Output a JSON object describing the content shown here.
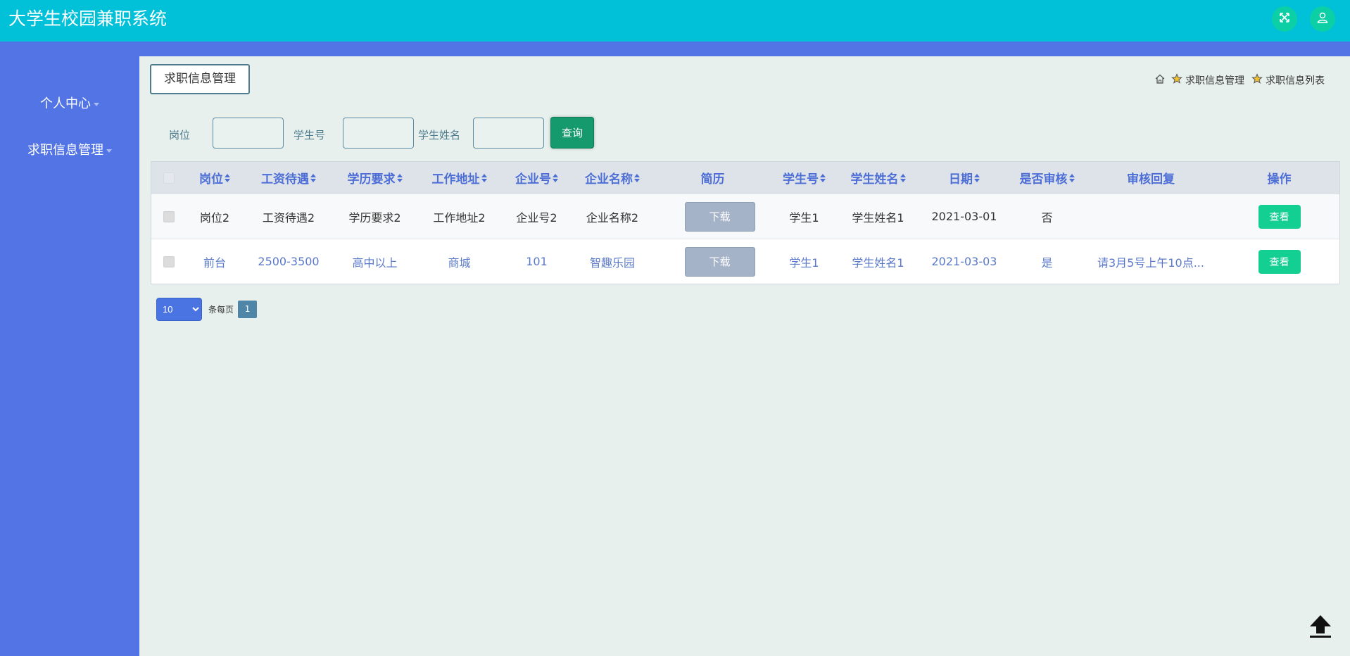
{
  "app": {
    "title": "大学生校园兼职系统"
  },
  "header": {
    "fullscreen_icon": "fullscreen-icon",
    "user_icon": "user-icon",
    "accent": "#00c1d8"
  },
  "sidebar": {
    "items": [
      {
        "label": "个人中心"
      },
      {
        "label": "求职信息管理"
      }
    ]
  },
  "page": {
    "tab_title": "求职信息管理",
    "breadcrumb": {
      "home_icon": "home-icon",
      "items": [
        "求职信息管理",
        "求职信息列表"
      ]
    }
  },
  "search": {
    "fields": [
      {
        "label": "岗位",
        "value": ""
      },
      {
        "label": "学生号",
        "value": ""
      },
      {
        "label": "学生姓名",
        "value": ""
      }
    ],
    "button": "查询"
  },
  "table": {
    "headers": [
      "岗位",
      "工资待遇",
      "学历要求",
      "工作地址",
      "企业号",
      "企业名称",
      "简历",
      "学生号",
      "学生姓名",
      "日期",
      "是否审核",
      "审核回复",
      "操作"
    ],
    "rows": [
      {
        "post": "岗位2",
        "salary": "工资待遇2",
        "education": "学历要求2",
        "address": "工作地址2",
        "company_no": "企业号2",
        "company_name": "企业名称2",
        "resume": "下载",
        "student_no": "学生1",
        "student_name": "学生姓名1",
        "date": "2021-03-01",
        "reviewed": "否",
        "reply": "",
        "action": "查看"
      },
      {
        "post": "前台",
        "salary": "2500-3500",
        "education": "高中以上",
        "address": "商城",
        "company_no": "101",
        "company_name": "智趣乐园",
        "resume": "下载",
        "student_no": "学生1",
        "student_name": "学生姓名1",
        "date": "2021-03-03",
        "reviewed": "是",
        "reply": "请3月5号上午10点...",
        "action": "查看"
      }
    ]
  },
  "pagination": {
    "page_size": "10",
    "per_page_label": "条每页",
    "current_page": "1"
  },
  "back_to_top_icon": "arrow-up-icon"
}
